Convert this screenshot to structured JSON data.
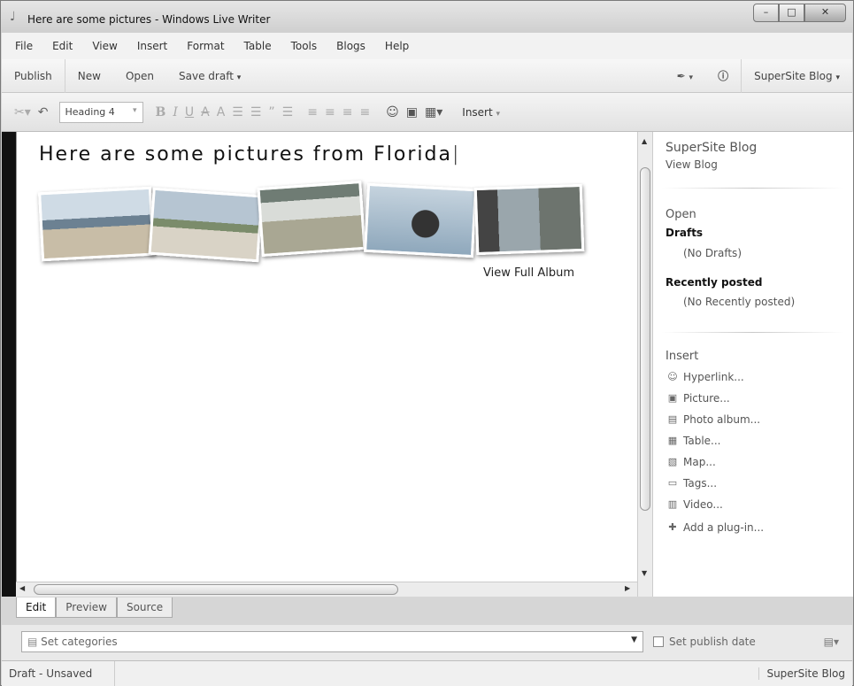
{
  "window": {
    "title": "Here are some pictures - Windows Live Writer"
  },
  "menu": [
    "File",
    "Edit",
    "View",
    "Insert",
    "Format",
    "Table",
    "Tools",
    "Blogs",
    "Help"
  ],
  "toolbar": {
    "publish": "Publish",
    "new": "New",
    "open": "Open",
    "save_draft": "Save draft",
    "blog_selector": "SuperSite Blog"
  },
  "format_bar": {
    "style_value": "Heading 4",
    "insert_label": "Insert"
  },
  "editor": {
    "post_title": "Here are some pictures from Florida",
    "album_link": "View Full Album"
  },
  "sidebar": {
    "blog_name": "SuperSite Blog",
    "view_blog": "View Blog",
    "open_heading": "Open",
    "drafts_label": "Drafts",
    "drafts_empty": "(No Drafts)",
    "recent_label": "Recently posted",
    "recent_empty": "(No Recently posted)",
    "insert_heading": "Insert",
    "insert_items": [
      "Hyperlink...",
      "Picture...",
      "Photo album...",
      "Table...",
      "Map...",
      "Tags...",
      "Video...",
      "Add a plug-in..."
    ]
  },
  "view_tabs": [
    "Edit",
    "Preview",
    "Source"
  ],
  "categories": {
    "placeholder": "Set categories",
    "publish_date": "Set publish date"
  },
  "status": {
    "left": "Draft - Unsaved",
    "right": "SuperSite Blog"
  }
}
